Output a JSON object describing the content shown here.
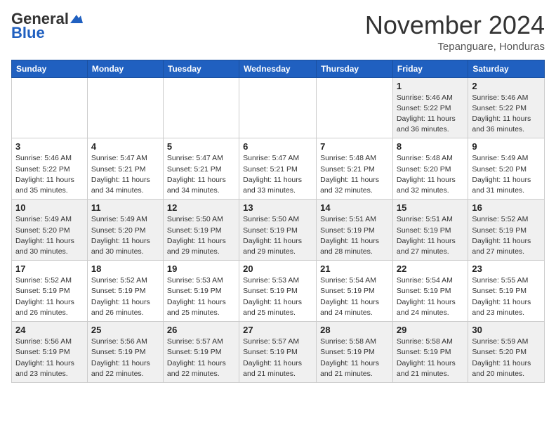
{
  "header": {
    "logo_general": "General",
    "logo_blue": "Blue",
    "month_title": "November 2024",
    "subtitle": "Tepanguare, Honduras"
  },
  "days_of_week": [
    "Sunday",
    "Monday",
    "Tuesday",
    "Wednesday",
    "Thursday",
    "Friday",
    "Saturday"
  ],
  "weeks": [
    [
      {
        "day": "",
        "info": ""
      },
      {
        "day": "",
        "info": ""
      },
      {
        "day": "",
        "info": ""
      },
      {
        "day": "",
        "info": ""
      },
      {
        "day": "",
        "info": ""
      },
      {
        "day": "1",
        "info": "Sunrise: 5:46 AM\nSunset: 5:22 PM\nDaylight: 11 hours\nand 36 minutes."
      },
      {
        "day": "2",
        "info": "Sunrise: 5:46 AM\nSunset: 5:22 PM\nDaylight: 11 hours\nand 36 minutes."
      }
    ],
    [
      {
        "day": "3",
        "info": "Sunrise: 5:46 AM\nSunset: 5:22 PM\nDaylight: 11 hours\nand 35 minutes."
      },
      {
        "day": "4",
        "info": "Sunrise: 5:47 AM\nSunset: 5:21 PM\nDaylight: 11 hours\nand 34 minutes."
      },
      {
        "day": "5",
        "info": "Sunrise: 5:47 AM\nSunset: 5:21 PM\nDaylight: 11 hours\nand 34 minutes."
      },
      {
        "day": "6",
        "info": "Sunrise: 5:47 AM\nSunset: 5:21 PM\nDaylight: 11 hours\nand 33 minutes."
      },
      {
        "day": "7",
        "info": "Sunrise: 5:48 AM\nSunset: 5:21 PM\nDaylight: 11 hours\nand 32 minutes."
      },
      {
        "day": "8",
        "info": "Sunrise: 5:48 AM\nSunset: 5:20 PM\nDaylight: 11 hours\nand 32 minutes."
      },
      {
        "day": "9",
        "info": "Sunrise: 5:49 AM\nSunset: 5:20 PM\nDaylight: 11 hours\nand 31 minutes."
      }
    ],
    [
      {
        "day": "10",
        "info": "Sunrise: 5:49 AM\nSunset: 5:20 PM\nDaylight: 11 hours\nand 30 minutes."
      },
      {
        "day": "11",
        "info": "Sunrise: 5:49 AM\nSunset: 5:20 PM\nDaylight: 11 hours\nand 30 minutes."
      },
      {
        "day": "12",
        "info": "Sunrise: 5:50 AM\nSunset: 5:19 PM\nDaylight: 11 hours\nand 29 minutes."
      },
      {
        "day": "13",
        "info": "Sunrise: 5:50 AM\nSunset: 5:19 PM\nDaylight: 11 hours\nand 29 minutes."
      },
      {
        "day": "14",
        "info": "Sunrise: 5:51 AM\nSunset: 5:19 PM\nDaylight: 11 hours\nand 28 minutes."
      },
      {
        "day": "15",
        "info": "Sunrise: 5:51 AM\nSunset: 5:19 PM\nDaylight: 11 hours\nand 27 minutes."
      },
      {
        "day": "16",
        "info": "Sunrise: 5:52 AM\nSunset: 5:19 PM\nDaylight: 11 hours\nand 27 minutes."
      }
    ],
    [
      {
        "day": "17",
        "info": "Sunrise: 5:52 AM\nSunset: 5:19 PM\nDaylight: 11 hours\nand 26 minutes."
      },
      {
        "day": "18",
        "info": "Sunrise: 5:52 AM\nSunset: 5:19 PM\nDaylight: 11 hours\nand 26 minutes."
      },
      {
        "day": "19",
        "info": "Sunrise: 5:53 AM\nSunset: 5:19 PM\nDaylight: 11 hours\nand 25 minutes."
      },
      {
        "day": "20",
        "info": "Sunrise: 5:53 AM\nSunset: 5:19 PM\nDaylight: 11 hours\nand 25 minutes."
      },
      {
        "day": "21",
        "info": "Sunrise: 5:54 AM\nSunset: 5:19 PM\nDaylight: 11 hours\nand 24 minutes."
      },
      {
        "day": "22",
        "info": "Sunrise: 5:54 AM\nSunset: 5:19 PM\nDaylight: 11 hours\nand 24 minutes."
      },
      {
        "day": "23",
        "info": "Sunrise: 5:55 AM\nSunset: 5:19 PM\nDaylight: 11 hours\nand 23 minutes."
      }
    ],
    [
      {
        "day": "24",
        "info": "Sunrise: 5:56 AM\nSunset: 5:19 PM\nDaylight: 11 hours\nand 23 minutes."
      },
      {
        "day": "25",
        "info": "Sunrise: 5:56 AM\nSunset: 5:19 PM\nDaylight: 11 hours\nand 22 minutes."
      },
      {
        "day": "26",
        "info": "Sunrise: 5:57 AM\nSunset: 5:19 PM\nDaylight: 11 hours\nand 22 minutes."
      },
      {
        "day": "27",
        "info": "Sunrise: 5:57 AM\nSunset: 5:19 PM\nDaylight: 11 hours\nand 21 minutes."
      },
      {
        "day": "28",
        "info": "Sunrise: 5:58 AM\nSunset: 5:19 PM\nDaylight: 11 hours\nand 21 minutes."
      },
      {
        "day": "29",
        "info": "Sunrise: 5:58 AM\nSunset: 5:19 PM\nDaylight: 11 hours\nand 21 minutes."
      },
      {
        "day": "30",
        "info": "Sunrise: 5:59 AM\nSunset: 5:20 PM\nDaylight: 11 hours\nand 20 minutes."
      }
    ]
  ]
}
